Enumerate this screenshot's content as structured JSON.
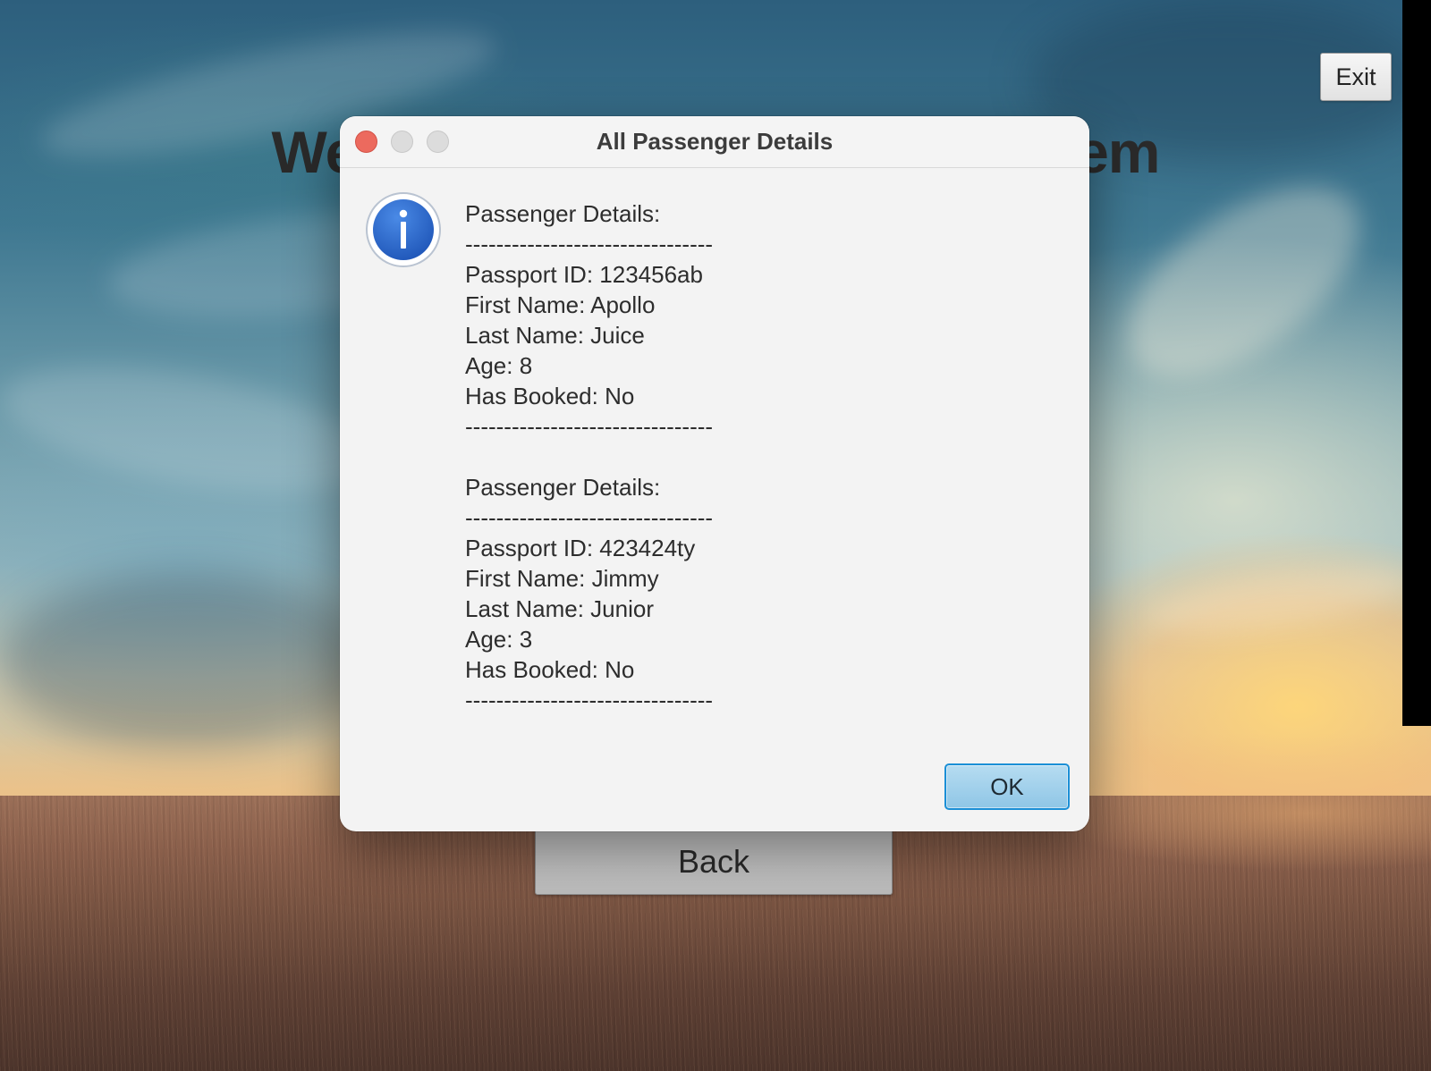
{
  "window": {
    "welcome_title": "Welcome to the Booking System",
    "exit_label": "Exit",
    "back_label": "Back"
  },
  "dialog": {
    "title": "All Passenger Details",
    "icon": "info-icon",
    "ok_label": "OK",
    "lines": [
      "Passenger Details:",
      "--------------------------------",
      "Passport ID: 123456ab",
      "First Name: Apollo",
      "Last Name: Juice",
      "Age: 8",
      "Has Booked: No",
      "--------------------------------",
      "",
      "Passenger Details:",
      "--------------------------------",
      "Passport ID: 423424ty",
      "First Name: Jimmy",
      "Last Name: Junior",
      "Age: 3",
      "Has Booked: No",
      "--------------------------------"
    ]
  },
  "colors": {
    "close_button": "#ec6a5e",
    "ok_border": "#1b8fd6",
    "info_icon": "#2f6fd0"
  }
}
